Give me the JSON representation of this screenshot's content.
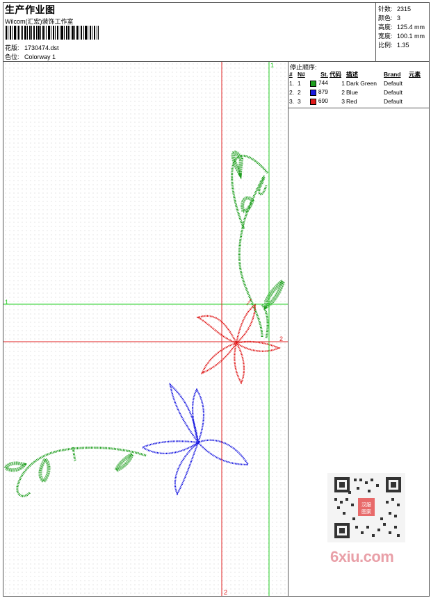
{
  "header": {
    "title": "生产作业图",
    "company": "Wilcom(汇宏)装饰工作室",
    "design_label": "花版:",
    "design_value": "1730474.dst",
    "colorway_label": "色位:",
    "colorway_value": "Colorway 1"
  },
  "stats": [
    {
      "label": "针数:",
      "value": "2315"
    },
    {
      "label": "颜色:",
      "value": "3"
    },
    {
      "label": "高度:",
      "value": "125.4 mm"
    },
    {
      "label": "宽度:",
      "value": "100.1 mm"
    },
    {
      "label": "比例:",
      "value": "1.35"
    }
  ],
  "stop_sequence": {
    "title": "停止顺序:",
    "columns": [
      "#",
      "N#",
      "St.",
      "代码",
      "描述",
      "Brand",
      "元素"
    ],
    "rows": [
      {
        "num": "1.",
        "n": "1",
        "color": "#1e9e1e",
        "stitches": "744",
        "code": "1",
        "desc": "Dark Green",
        "brand": "Default"
      },
      {
        "num": "2.",
        "n": "2",
        "color": "#1a1ae0",
        "stitches": "879",
        "code": "2",
        "desc": "Blue",
        "brand": "Default"
      },
      {
        "num": "3.",
        "n": "3",
        "color": "#e01a1a",
        "stitches": "690",
        "code": "3",
        "desc": "Red",
        "brand": "Default"
      }
    ]
  },
  "guides": {
    "green_v_label": "1",
    "green_h_label": "1",
    "red_h_label": "2",
    "red_v_label": "2",
    "green_color": "#22cc22",
    "red_color": "#e02020"
  },
  "watermark": {
    "text": "6xiu.com",
    "qr_badge": "汉服图案"
  }
}
